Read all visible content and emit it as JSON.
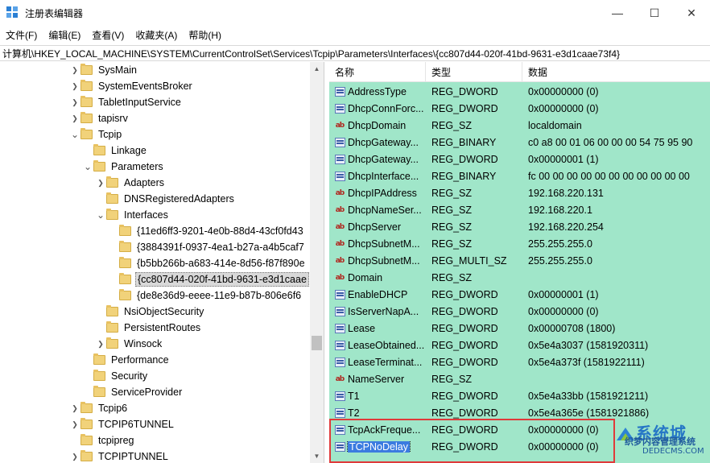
{
  "window": {
    "title": "注册表编辑器",
    "controls": [
      "—",
      "☐",
      "✕"
    ]
  },
  "menu": [
    "文件(F)",
    "编辑(E)",
    "查看(V)",
    "收藏夹(A)",
    "帮助(H)"
  ],
  "address": "计算机\\HKEY_LOCAL_MACHINE\\SYSTEM\\CurrentControlSet\\Services\\Tcpip\\Parameters\\Interfaces\\{cc807d44-020f-41bd-9631-e3d1caae73f4}",
  "tree": [
    {
      "label": "SysMain",
      "level": 0,
      "expander": "collapsed"
    },
    {
      "label": "SystemEventsBroker",
      "level": 0,
      "expander": "collapsed"
    },
    {
      "label": "TabletInputService",
      "level": 0,
      "expander": "collapsed"
    },
    {
      "label": "tapisrv",
      "level": 0,
      "expander": "collapsed"
    },
    {
      "label": "Tcpip",
      "level": 0,
      "expander": "expanded"
    },
    {
      "label": "Linkage",
      "level": 1,
      "expander": "none"
    },
    {
      "label": "Parameters",
      "level": 1,
      "expander": "expanded"
    },
    {
      "label": "Adapters",
      "level": 2,
      "expander": "collapsed"
    },
    {
      "label": "DNSRegisteredAdapters",
      "level": 2,
      "expander": "none"
    },
    {
      "label": "Interfaces",
      "level": 2,
      "expander": "expanded"
    },
    {
      "label": "{11ed6ff3-9201-4e0b-88d4-43cf0fd43",
      "level": 3,
      "expander": "none"
    },
    {
      "label": "{3884391f-0937-4ea1-b27a-a4b5caf7",
      "level": 3,
      "expander": "none"
    },
    {
      "label": "{b5bb266b-a683-414e-8d56-f87f890e",
      "level": 3,
      "expander": "none"
    },
    {
      "label": "{cc807d44-020f-41bd-9631-e3d1caae",
      "level": 3,
      "expander": "none",
      "selected": true
    },
    {
      "label": "{de8e36d9-eeee-11e9-b87b-806e6f6",
      "level": 3,
      "expander": "none"
    },
    {
      "label": "NsiObjectSecurity",
      "level": 2,
      "expander": "none"
    },
    {
      "label": "PersistentRoutes",
      "level": 2,
      "expander": "none"
    },
    {
      "label": "Winsock",
      "level": 2,
      "expander": "collapsed"
    },
    {
      "label": "Performance",
      "level": 1,
      "expander": "none"
    },
    {
      "label": "Security",
      "level": 1,
      "expander": "none"
    },
    {
      "label": "ServiceProvider",
      "level": 1,
      "expander": "none"
    },
    {
      "label": "Tcpip6",
      "level": 0,
      "expander": "collapsed"
    },
    {
      "label": "TCPIP6TUNNEL",
      "level": 0,
      "expander": "collapsed"
    },
    {
      "label": "tcpipreg",
      "level": 0,
      "expander": "none"
    },
    {
      "label": "TCPIPTUNNEL",
      "level": 0,
      "expander": "collapsed"
    }
  ],
  "columns": {
    "name": "名称",
    "type": "类型",
    "data": "数据"
  },
  "values": [
    {
      "name": "AddressType",
      "type": "REG_DWORD",
      "data": "0x00000000 (0)",
      "icon": "binary-value-icon"
    },
    {
      "name": "DhcpConnForc...",
      "type": "REG_DWORD",
      "data": "0x00000000 (0)",
      "icon": "binary-value-icon"
    },
    {
      "name": "DhcpDomain",
      "type": "REG_SZ",
      "data": "localdomain",
      "icon": "string-value-icon"
    },
    {
      "name": "DhcpGateway...",
      "type": "REG_BINARY",
      "data": "c0 a8 00 01 06 00 00 00 54 75 95 90",
      "icon": "binary-value-icon"
    },
    {
      "name": "DhcpGateway...",
      "type": "REG_DWORD",
      "data": "0x00000001 (1)",
      "icon": "binary-value-icon"
    },
    {
      "name": "DhcpInterface...",
      "type": "REG_BINARY",
      "data": "fc 00 00 00 00 00 00 00 00 00 00 00",
      "icon": "binary-value-icon"
    },
    {
      "name": "DhcpIPAddress",
      "type": "REG_SZ",
      "data": "192.168.220.131",
      "icon": "string-value-icon"
    },
    {
      "name": "DhcpNameSer...",
      "type": "REG_SZ",
      "data": "192.168.220.1",
      "icon": "string-value-icon"
    },
    {
      "name": "DhcpServer",
      "type": "REG_SZ",
      "data": "192.168.220.254",
      "icon": "string-value-icon"
    },
    {
      "name": "DhcpSubnetM...",
      "type": "REG_SZ",
      "data": "255.255.255.0",
      "icon": "string-value-icon"
    },
    {
      "name": "DhcpSubnetM...",
      "type": "REG_MULTI_SZ",
      "data": "255.255.255.0",
      "icon": "string-value-icon"
    },
    {
      "name": "Domain",
      "type": "REG_SZ",
      "data": "",
      "icon": "string-value-icon"
    },
    {
      "name": "EnableDHCP",
      "type": "REG_DWORD",
      "data": "0x00000001 (1)",
      "icon": "binary-value-icon"
    },
    {
      "name": "IsServerNapA...",
      "type": "REG_DWORD",
      "data": "0x00000000 (0)",
      "icon": "binary-value-icon"
    },
    {
      "name": "Lease",
      "type": "REG_DWORD",
      "data": "0x00000708 (1800)",
      "icon": "binary-value-icon"
    },
    {
      "name": "LeaseObtained...",
      "type": "REG_DWORD",
      "data": "0x5e4a3037 (1581920311)",
      "icon": "binary-value-icon"
    },
    {
      "name": "LeaseTerminat...",
      "type": "REG_DWORD",
      "data": "0x5e4a373f (1581922111)",
      "icon": "binary-value-icon"
    },
    {
      "name": "NameServer",
      "type": "REG_SZ",
      "data": "",
      "icon": "string-value-icon"
    },
    {
      "name": "T1",
      "type": "REG_DWORD",
      "data": "0x5e4a33bb (1581921211)",
      "icon": "binary-value-icon"
    },
    {
      "name": "T2",
      "type": "REG_DWORD",
      "data": "0x5e4a365e (1581921886)",
      "icon": "binary-value-icon"
    },
    {
      "name": "TcpAckFreque...",
      "type": "REG_DWORD",
      "data": "0x00000000 (0)",
      "icon": "binary-value-icon"
    },
    {
      "name": "TCPNoDelay",
      "type": "REG_DWORD",
      "data": "0x00000000 (0)",
      "icon": "binary-value-icon",
      "selected": true
    }
  ],
  "watermark": {
    "top": "系统城",
    "middle": "织梦内容管理系统",
    "bottom": "DEDECMS.COM"
  },
  "colors": {
    "values_background": "#a0e6c9",
    "selection": "#3b7be0",
    "highlight_box": "#e03a3a"
  }
}
